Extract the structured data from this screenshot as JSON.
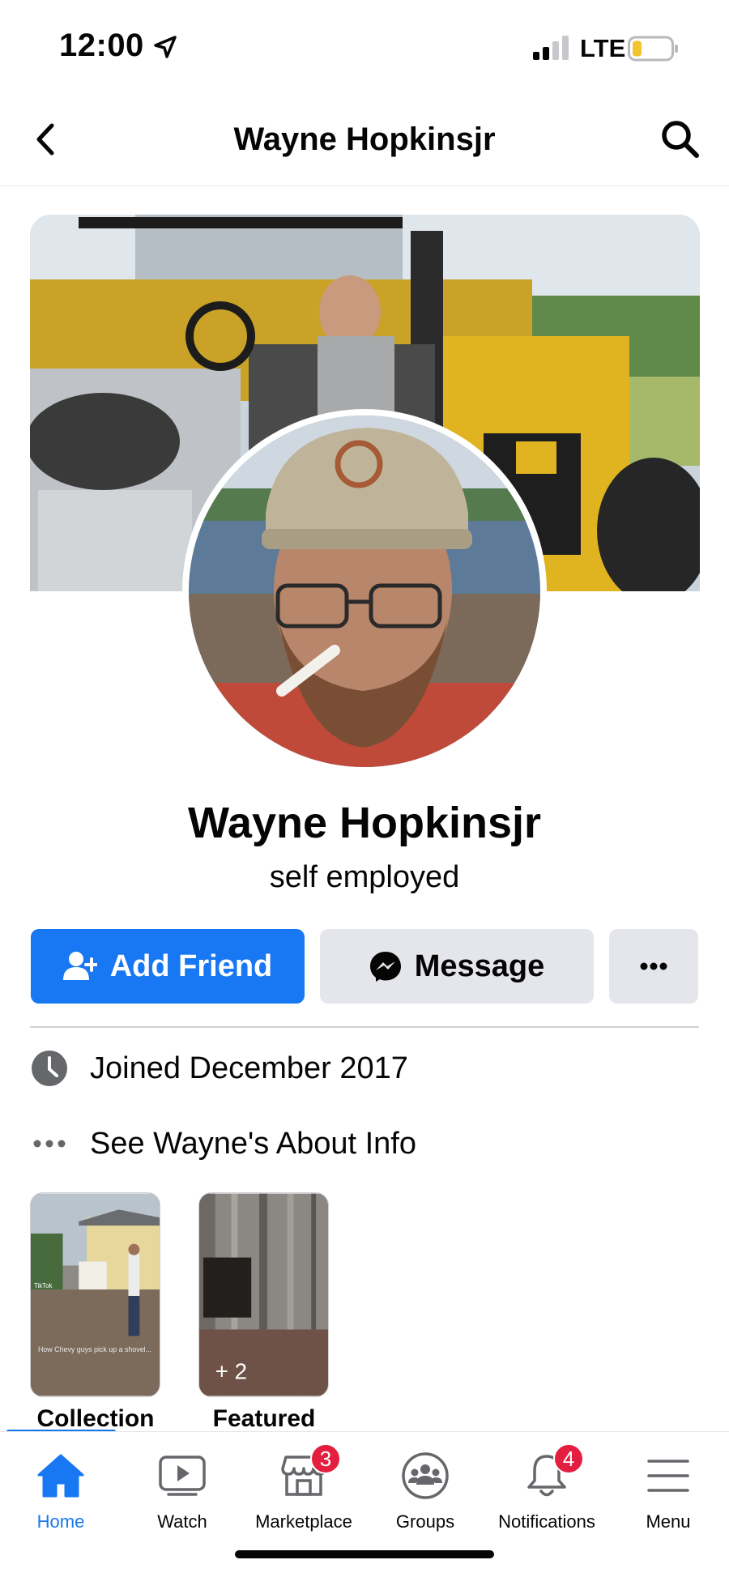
{
  "status_bar": {
    "time": "12:00",
    "network": "LTE",
    "battery_level": 0.2,
    "signal_bars": 2
  },
  "header": {
    "title": "Wayne Hopkinsjr",
    "back_icon": "chevron-left-icon",
    "search_icon": "search-icon"
  },
  "profile": {
    "name": "Wayne Hopkinsjr",
    "subtitle": "self employed",
    "cover_photo": "cover-photo",
    "profile_photo": "profile-photo"
  },
  "actions": {
    "add_friend": "Add Friend",
    "message": "Message",
    "more_icon": "more-dots-icon"
  },
  "info": [
    {
      "icon": "clock-icon",
      "text": "Joined December 2017"
    },
    {
      "icon": "more-dots-icon",
      "text": "See Wayne's About Info"
    }
  ],
  "highlights": [
    {
      "label": "Collection",
      "caption": "How Chevy guys pick up a shovel...",
      "watermark": "TikTok"
    },
    {
      "label": "Featured",
      "extra_count": "+ 2"
    }
  ],
  "tabs": [
    {
      "label": "Home",
      "icon": "home-icon",
      "active": true
    },
    {
      "label": "Watch",
      "icon": "watch-icon"
    },
    {
      "label": "Marketplace",
      "icon": "marketplace-icon",
      "badge": "3"
    },
    {
      "label": "Groups",
      "icon": "groups-icon"
    },
    {
      "label": "Notifications",
      "icon": "bell-icon",
      "badge": "4"
    },
    {
      "label": "Menu",
      "icon": "menu-icon"
    }
  ],
  "colors": {
    "accent": "#1877f2",
    "badge": "#e41e3f",
    "button_gray": "#e4e6eb"
  }
}
